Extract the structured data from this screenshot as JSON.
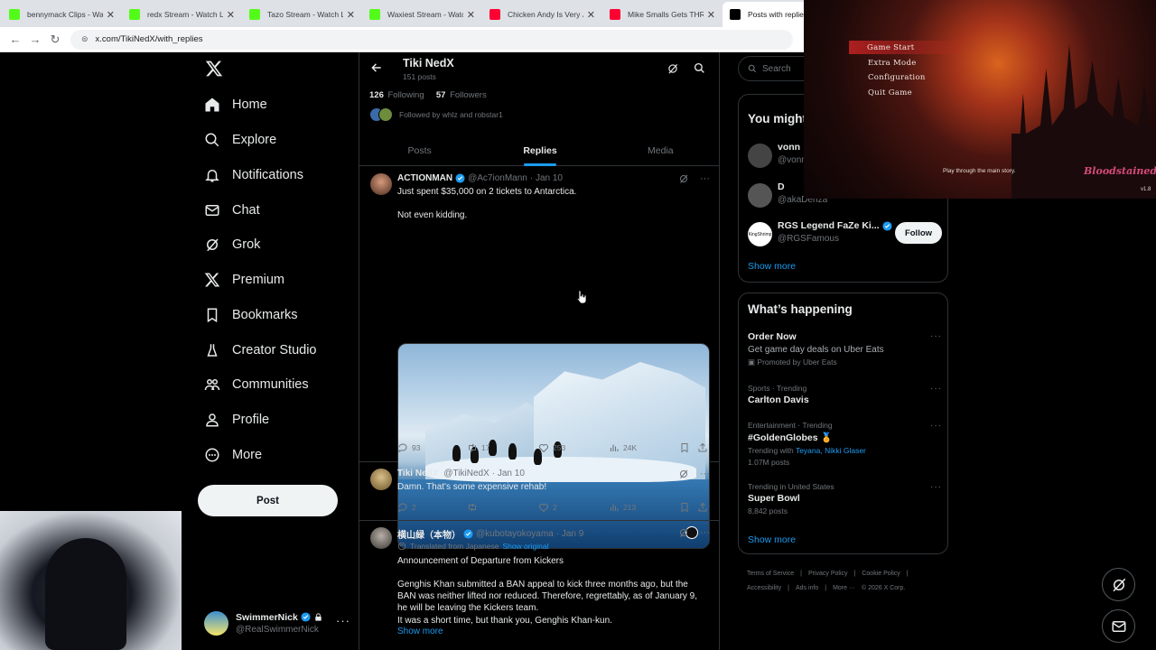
{
  "browser": {
    "tabs": [
      {
        "title": "bennymack Clips - Watc",
        "color": "#53fc18",
        "glyph": "K"
      },
      {
        "title": "redx Stream - Watch Liv",
        "color": "#53fc18",
        "glyph": "K"
      },
      {
        "title": "Tazo Stream - Watch Liv",
        "color": "#53fc18",
        "glyph": "K"
      },
      {
        "title": "Waxiest Stream - Watch",
        "color": "#53fc18",
        "glyph": "K"
      },
      {
        "title": "Chicken Andy Is Very Je",
        "color": "#ff0033",
        "glyph": "▶"
      },
      {
        "title": "Mike Smalls Gets THRO",
        "color": "#ff0033",
        "glyph": "▶"
      },
      {
        "title": "Posts with replies by",
        "color": "#000000",
        "glyph": "X"
      }
    ],
    "url": "x.com/TikiNedX/with_replies"
  },
  "nav": {
    "items": [
      {
        "label": "Home",
        "icon": "home-icon"
      },
      {
        "label": "Explore",
        "icon": "search-icon"
      },
      {
        "label": "Notifications",
        "icon": "bell-icon"
      },
      {
        "label": "Chat",
        "icon": "mail-icon"
      },
      {
        "label": "Grok",
        "icon": "grok-icon"
      },
      {
        "label": "Premium",
        "icon": "x-icon"
      },
      {
        "label": "Bookmarks",
        "icon": "bookmark-icon"
      },
      {
        "label": "Creator Studio",
        "icon": "flask-icon"
      },
      {
        "label": "Communities",
        "icon": "people-icon"
      },
      {
        "label": "Profile",
        "icon": "person-icon"
      },
      {
        "label": "More",
        "icon": "more-circle-icon"
      }
    ],
    "post_label": "Post",
    "account": {
      "name": "SwimmerNick",
      "handle": "@RealSwimmerNick"
    }
  },
  "profile": {
    "name": "Tiki NedX",
    "post_count": "151 posts",
    "following_count": "126",
    "following_label": "Following",
    "followers_count": "57",
    "followers_label": "Followers",
    "followed_by": "Followed by whlz and robstar1",
    "tabs": [
      "Posts",
      "Replies",
      "Media"
    ],
    "active_tab": "Replies"
  },
  "tweets": [
    {
      "name": "ACTIONMAN",
      "handle": "@Ac7ionMann",
      "date": "· Jan 10",
      "text1": "Just spent $35,000 on 2 tickets to Antarctica.",
      "text2": "Not even kidding.",
      "replies": "93",
      "retweets": "17",
      "likes": "253",
      "views": "24K"
    },
    {
      "name": "Tiki NedX",
      "handle": "@TikiNedX",
      "date": "· Jan 10",
      "text1": "Damn. That's some expensive rehab!",
      "replies": "2",
      "retweets": "",
      "likes": "2",
      "views": "213"
    },
    {
      "name": "横山緑（本物）",
      "handle": "@kubotayokoyama",
      "date": "· Jan 9",
      "translated": "Translated from Japanese",
      "show_original": "Show original",
      "text1": "Announcement of Departure from Kickers",
      "text2": "Genghis Khan submitted a BAN appeal to kick three months ago, but the BAN was neither lifted nor reduced. Therefore, regrettably, as of January 9, he will be leaving the Kickers team.",
      "text3": "It was a short time, but thank you, Genghis Khan-kun.",
      "show_more": "Show more"
    }
  ],
  "sidebar": {
    "search_placeholder": "Search",
    "who_to_follow_title": "You might",
    "suggestions": [
      {
        "name": "vonn",
        "handle": "@vonn"
      },
      {
        "name": "D",
        "handle": "@akaDenza"
      },
      {
        "name": "RGS Legend FaZe Ki...",
        "handle": "@RGSFamous",
        "follow": "Follow",
        "avatar_text": "KingShrimp"
      }
    ],
    "show_more": "Show more",
    "happening_title": "What’s happening",
    "trends": [
      {
        "l1": "Order Now",
        "l2": "Get game day deals on Uber Eats",
        "l3": "Promoted by Uber Eats"
      },
      {
        "l1": "Sports · Trending",
        "l2": "Carlton Davis"
      },
      {
        "l1": "Entertainment · Trending",
        "l2": "#GoldenGlobes 🏅",
        "l3_prefix": "Trending with",
        "l3_links": "Teyana, Nikki Glaser",
        "l4": "1.07M posts"
      },
      {
        "l1": "Trending in United States",
        "l2": "Super Bowl",
        "l3": "8,842 posts"
      }
    ],
    "show_more2": "Show more",
    "footer": [
      "Terms of Service",
      "|",
      "Privacy Policy",
      "|",
      "Cookie Policy",
      "|",
      "Accessibility",
      "|",
      "Ads info",
      "|",
      "More ···",
      "© 2026 X Corp."
    ]
  },
  "game": {
    "menu": [
      "Game Start",
      "Extra Mode",
      "Configuration",
      "Quit Game"
    ],
    "hint": "Play through the main story.",
    "logo": "Bloodstained",
    "version": "v1.8"
  },
  "colors": {
    "accent": "#1d9bf0",
    "bg": "#000000",
    "muted": "#71767b"
  }
}
